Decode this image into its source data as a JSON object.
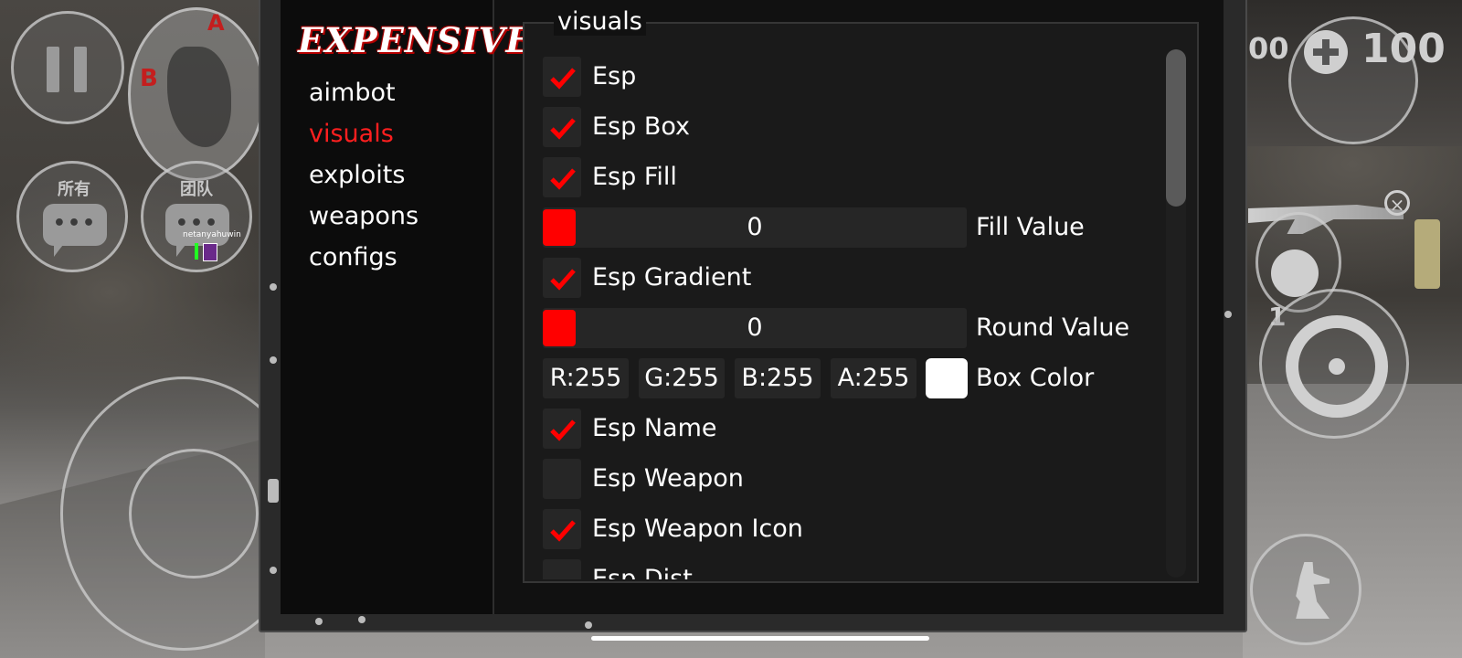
{
  "game_hud": {
    "chat_all_label": "所有",
    "chat_team_label": "团队",
    "minimap_marker_a": "A",
    "minimap_marker_b": "B",
    "player_name": "netanyahuwin",
    "health_value": "100",
    "armor_value_partial": "00",
    "grenade_count": "1"
  },
  "menu": {
    "logo": "EXPENSIVE",
    "nav": [
      {
        "label": "aimbot",
        "active": false
      },
      {
        "label": "visuals",
        "active": true
      },
      {
        "label": "exploits",
        "active": false
      },
      {
        "label": "weapons",
        "active": false
      },
      {
        "label": "configs",
        "active": false
      }
    ],
    "panel_title": "visuals",
    "accent_color": "#ff1f1f",
    "options": {
      "esp": {
        "label": "Esp",
        "checked": true
      },
      "esp_box": {
        "label": "Esp Box",
        "checked": true
      },
      "esp_fill": {
        "label": "Esp Fill",
        "checked": true
      },
      "fill_value": {
        "label": "Fill Value",
        "value": "0"
      },
      "esp_gradient": {
        "label": "Esp Gradient",
        "checked": true
      },
      "round_value": {
        "label": "Round Value",
        "value": "0"
      },
      "box_color": {
        "label": "Box Color",
        "r": "R:255",
        "g": "G:255",
        "b": "B:255",
        "a": "A:255",
        "swatch": "#ffffff"
      },
      "esp_name": {
        "label": "Esp Name",
        "checked": true
      },
      "esp_weapon": {
        "label": "Esp Weapon",
        "checked": false
      },
      "esp_weapon_icon": {
        "label": "Esp Weapon Icon",
        "checked": true
      },
      "esp_distance_partial": {
        "label": "Esp Dist",
        "checked": false
      }
    }
  }
}
